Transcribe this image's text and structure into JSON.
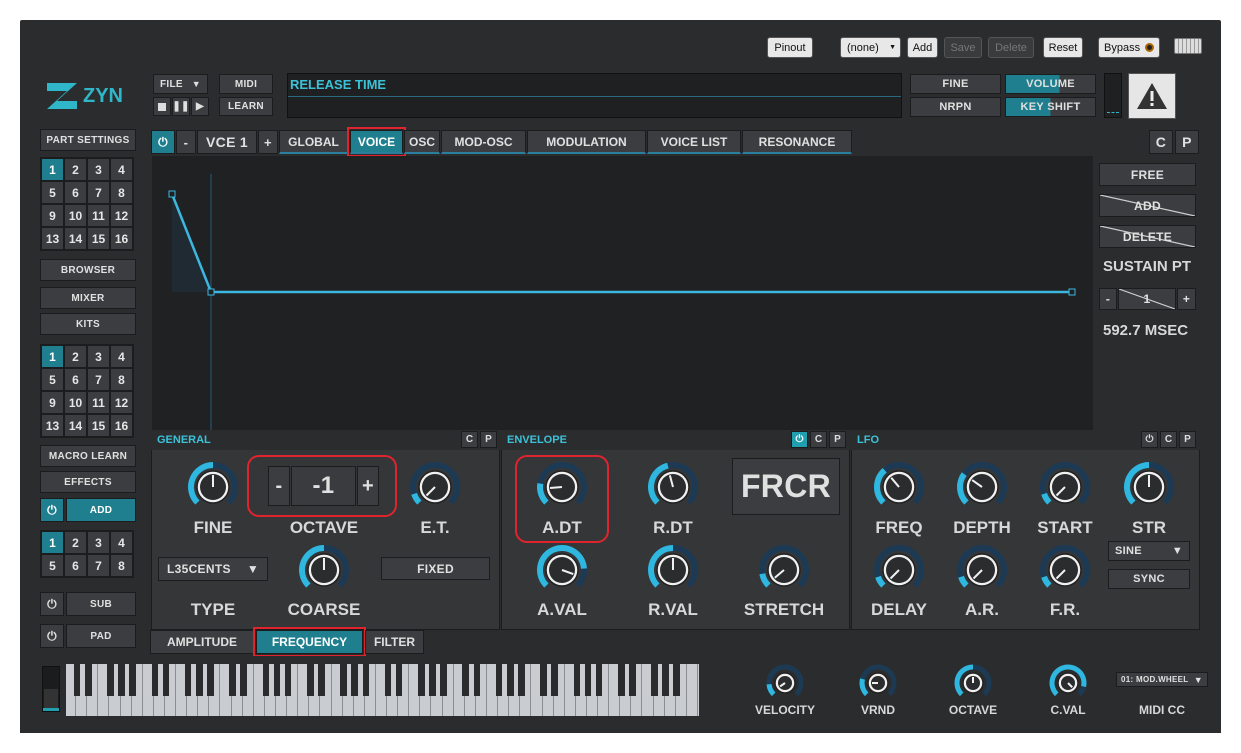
{
  "header": {
    "pinout": "Pinout",
    "preset": "(none)",
    "add": "Add",
    "save": "Save",
    "delete": "Delete",
    "reset": "Reset",
    "bypass": "Bypass"
  },
  "logo": {
    "text": "ZYN"
  },
  "transport": {
    "file": "FILE",
    "midi": "MIDI",
    "learn": "LEARN"
  },
  "display": {
    "line1": "RELEASE TIME",
    "line2": ""
  },
  "right_top": {
    "fine": "FINE",
    "volume": "VOLUME",
    "nrpn": "NRPN",
    "key_shift": "KEY SHIFT"
  },
  "sidebar": {
    "part_settings": "PART SETTINGS",
    "browser": "BROWSER",
    "mixer": "MIXER",
    "kits": "KITS",
    "macro_learn": "MACRO LEARN",
    "effects": "EFFECTS",
    "add": "ADD",
    "sub": "SUB",
    "pad": "PAD",
    "grid1": [
      "1",
      "2",
      "3",
      "4",
      "5",
      "6",
      "7",
      "8",
      "9",
      "10",
      "11",
      "12",
      "13",
      "14",
      "15",
      "16"
    ],
    "grid2": [
      "1",
      "2",
      "3",
      "4",
      "5",
      "6",
      "7",
      "8",
      "9",
      "10",
      "11",
      "12",
      "13",
      "14",
      "15",
      "16"
    ],
    "grid3": [
      "1",
      "2",
      "3",
      "4",
      "5",
      "6",
      "7",
      "8"
    ]
  },
  "tabs": {
    "minus": "-",
    "voice_name": "VCE 1",
    "plus": "+",
    "global": "GLOBAL",
    "voice": "VOICE",
    "osc": "OSC",
    "mod_osc": "MOD-OSC",
    "modulation": "MODULATION",
    "voice_list": "VOICE LIST",
    "resonance": "RESONANCE",
    "c": "C",
    "p": "P"
  },
  "envelope_editor": {
    "free": "FREE",
    "add": "ADD",
    "delete": "DELETE",
    "sustain_label": "SUSTAIN PT",
    "sustain_value": "1",
    "minus": "-",
    "plus": "+",
    "time": "592.7 MSEC"
  },
  "general": {
    "title": "GENERAL",
    "fine": "FINE",
    "octave": "OCTAVE",
    "octave_value": "-1",
    "octave_minus": "-",
    "octave_plus": "+",
    "et": "E.T.",
    "type_value": "L35CENTS",
    "type": "TYPE",
    "coarse": "COARSE",
    "fixed": "FIXED",
    "c": "C",
    "p": "P"
  },
  "envelope": {
    "title": "ENVELOPE",
    "adt": "A.DT",
    "rdt": "R.DT",
    "frcr": "FRCR",
    "aval": "A.VAL",
    "rval": "R.VAL",
    "stretch": "STRETCH",
    "c": "C",
    "p": "P"
  },
  "lfo": {
    "title": "LFO",
    "freq": "FREQ",
    "depth": "DEPTH",
    "start": "START",
    "str": "STR",
    "delay": "DELAY",
    "ar": "A.R.",
    "fr": "F.R.",
    "shape": "SINE",
    "sync": "SYNC",
    "c": "C",
    "p": "P"
  },
  "bottom_tabs": {
    "amplitude": "AMPLITUDE",
    "frequency": "FREQUENCY",
    "filter": "FILTER"
  },
  "keyboard": {
    "velocity": "VELOCITY",
    "vrnd": "VRND",
    "octave": "OCTAVE",
    "cval": "C.VAL",
    "midi_cc": "MIDI CC",
    "midi_cc_value": "01: MOD.WHEEL"
  },
  "colors": {
    "accent": "#1f9fb0",
    "highlight": "#e0242e",
    "bg": "#2b2c2e"
  }
}
